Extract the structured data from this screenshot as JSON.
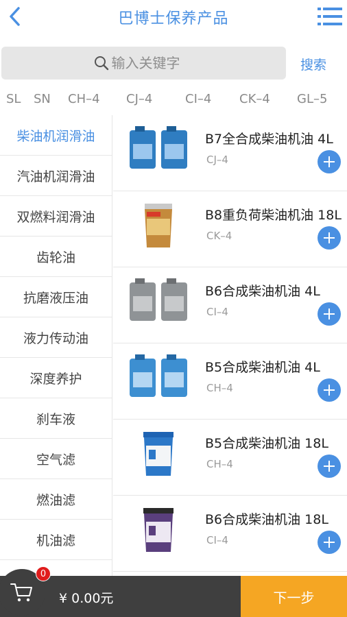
{
  "header": {
    "title": "巴博士保养产品",
    "back_icon": "chevron-left-icon",
    "menu_icon": "list-menu-icon",
    "accent_color": "#4a90e2"
  },
  "search": {
    "placeholder": "输入关键字",
    "button_label": "搜索"
  },
  "spec_filters": [
    "SL",
    "SN",
    "CH–4",
    "CJ–4",
    "CI–4",
    "CK–4",
    "GL–5"
  ],
  "categories": [
    {
      "label": "柴油机润滑油",
      "active": true
    },
    {
      "label": "汽油机润滑油"
    },
    {
      "label": "双燃料润滑油"
    },
    {
      "label": "齿轮油"
    },
    {
      "label": "抗磨液压油"
    },
    {
      "label": "液力传动油"
    },
    {
      "label": "深度养护"
    },
    {
      "label": "刹车液"
    },
    {
      "label": "空气滤"
    },
    {
      "label": "燃油滤"
    },
    {
      "label": "机油滤"
    },
    {
      "label": ""
    }
  ],
  "products": [
    {
      "name": "B7全合成柴油机油 4L",
      "spec": "CJ–4",
      "image": "blue-jug-pair"
    },
    {
      "name": "B8重负荷柴油机油 18L",
      "spec": "CK–4",
      "image": "orange-bucket"
    },
    {
      "name": "B6合成柴油机油 4L",
      "spec": "CI–4",
      "image": "gray-jug-pair"
    },
    {
      "name": "B5合成柴油机油 4L",
      "spec": "CH–4",
      "image": "blue-jug-pair"
    },
    {
      "name": "B5合成柴油机油 18L",
      "spec": "CH–4",
      "image": "blue-bucket"
    },
    {
      "name": "B6合成柴油机油 18L",
      "spec": "CI–4",
      "image": "purple-bucket"
    }
  ],
  "cart": {
    "count": "0",
    "total": "¥ 0.00元",
    "next_label": "下一步",
    "next_color": "#f5a623"
  }
}
